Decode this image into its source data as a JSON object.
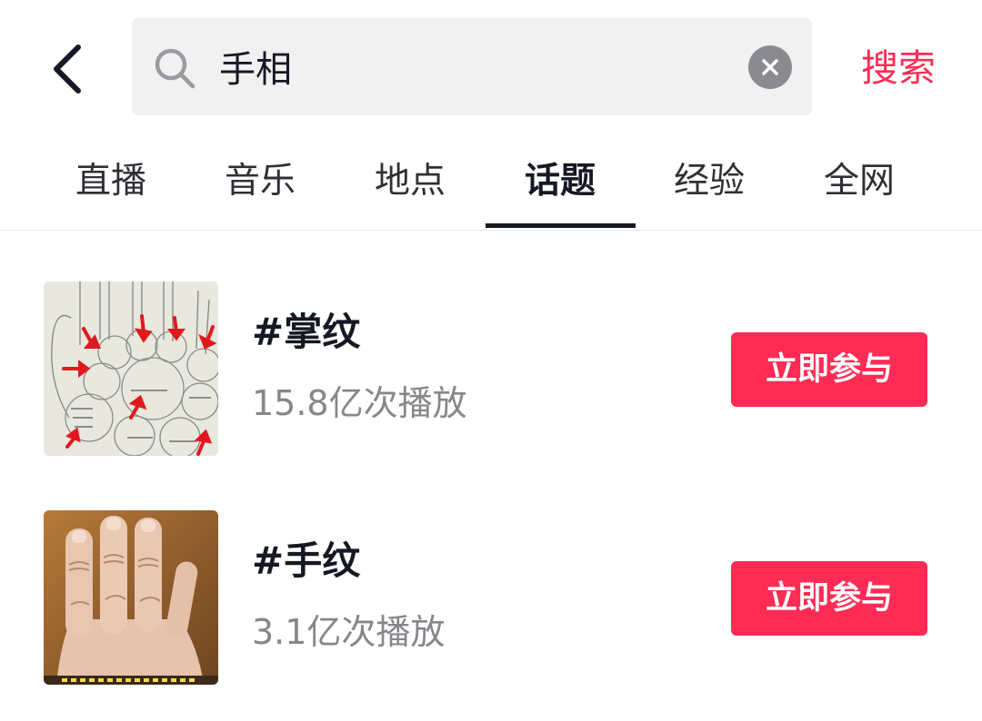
{
  "header": {
    "back_icon": "chevron-left-icon",
    "search": {
      "icon": "search-icon",
      "value": "手相",
      "placeholder": "",
      "clear_icon": "close-circle-icon"
    },
    "submit_label": "搜索",
    "accent_color": "#fe2c55"
  },
  "tabs": [
    {
      "label": "直播",
      "active": false
    },
    {
      "label": "音乐",
      "active": false
    },
    {
      "label": "地点",
      "active": false
    },
    {
      "label": "话题",
      "active": true
    },
    {
      "label": "经验",
      "active": false
    },
    {
      "label": "全网",
      "active": false
    }
  ],
  "topics": [
    {
      "title": "#掌纹",
      "plays": "15.8亿次播放",
      "button_label": "立即参与",
      "thumbnail": "palm-chart-sketch"
    },
    {
      "title": "#手纹",
      "plays": "3.1亿次播放",
      "button_label": "立即参与",
      "thumbnail": "hand-fingers-photo"
    }
  ]
}
